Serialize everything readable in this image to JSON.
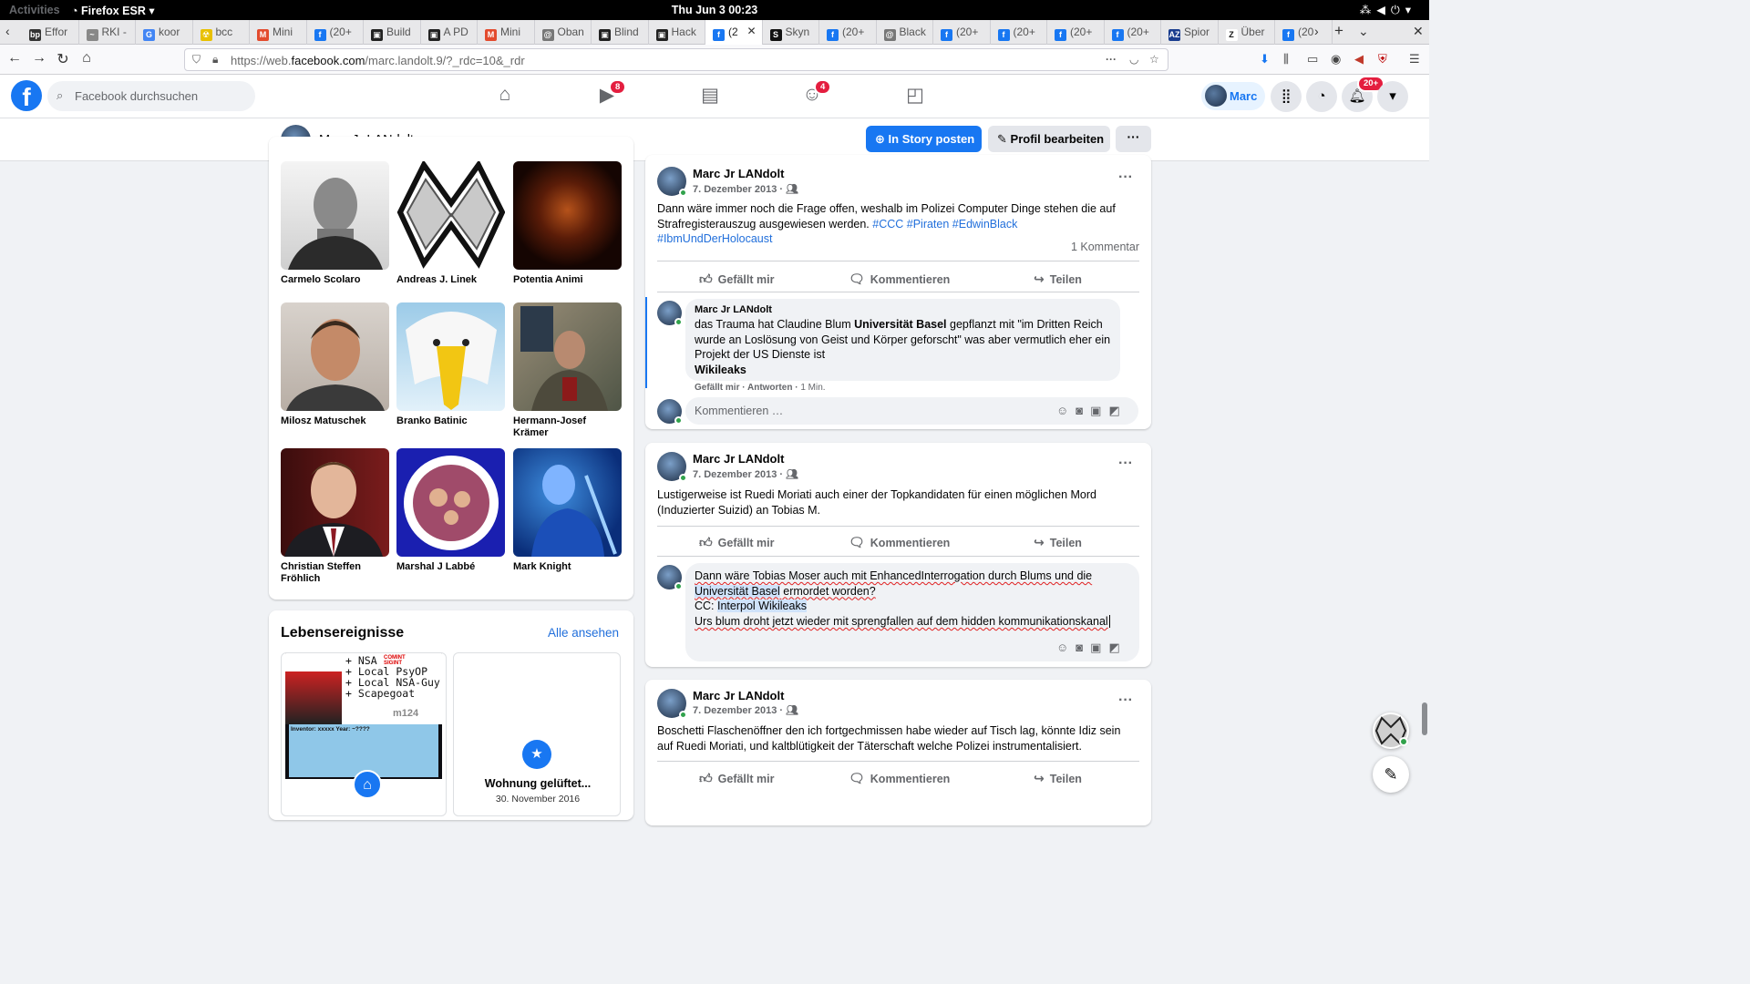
{
  "system": {
    "activities": "Activities",
    "app_name": "Firefox ESR",
    "clock": "Thu Jun 3  00:23"
  },
  "tabs": [
    {
      "label": "Effor",
      "fav_text": "bp",
      "fav_color": "#333333"
    },
    {
      "label": "RKI -",
      "fav_text": "~",
      "fav_color": "#888888"
    },
    {
      "label": "koor",
      "fav_text": "G",
      "fav_color": "#4285f4"
    },
    {
      "label": "bcc",
      "fav_text": "☢",
      "fav_color": "#e8c000"
    },
    {
      "label": "Mini",
      "fav_text": "M",
      "fav_color": "#e34b2e"
    },
    {
      "label": "(20+",
      "fav_text": "f",
      "fav_color": "#1877f2"
    },
    {
      "label": "Build",
      "fav_text": "▣",
      "fav_color": "#222222"
    },
    {
      "label": "A PD",
      "fav_text": "▣",
      "fav_color": "#222222"
    },
    {
      "label": "Mini",
      "fav_text": "M",
      "fav_color": "#e34b2e"
    },
    {
      "label": "Oban",
      "fav_text": "@",
      "fav_color": "#777777"
    },
    {
      "label": "Blind",
      "fav_text": "▣",
      "fav_color": "#222222"
    },
    {
      "label": "Hack",
      "fav_text": "▣",
      "fav_color": "#222222"
    },
    {
      "label": "(2",
      "fav_text": "f",
      "fav_color": "#1877f2",
      "active": true
    },
    {
      "label": "Skyn",
      "fav_text": "S",
      "fav_color": "#111111"
    },
    {
      "label": "(20+",
      "fav_text": "f",
      "fav_color": "#1877f2"
    },
    {
      "label": "Black",
      "fav_text": "@",
      "fav_color": "#777777"
    },
    {
      "label": "(20+",
      "fav_text": "f",
      "fav_color": "#1877f2"
    },
    {
      "label": "(20+",
      "fav_text": "f",
      "fav_color": "#1877f2"
    },
    {
      "label": "(20+",
      "fav_text": "f",
      "fav_color": "#1877f2"
    },
    {
      "label": "(20+",
      "fav_text": "f",
      "fav_color": "#1877f2"
    },
    {
      "label": "Spior",
      "fav_text": "AZ",
      "fav_color": "#1a3d8f"
    },
    {
      "label": "Über",
      "fav_text": "Z",
      "fav_color": "#ffffff"
    },
    {
      "label": "(20",
      "fav_text": "f",
      "fav_color": "#1877f2"
    }
  ],
  "url": {
    "prefix": "https://web.",
    "domain": "facebook.com",
    "path": "/marc.landolt.9/?_rdc=10&_rdr"
  },
  "fb": {
    "search_placeholder": "Facebook durchsuchen",
    "watch_badge": "8",
    "groups_badge": "4",
    "me_label": "Marc",
    "notif_badge": "20+"
  },
  "profile": {
    "name": "Marc Jr LANdolt",
    "story_btn": "In Story posten",
    "edit_btn": "Profil bearbeiten",
    "more_btn": "···"
  },
  "friends": [
    {
      "name": "Carmelo Scolaro"
    },
    {
      "name": "Andreas J. Linek"
    },
    {
      "name": "Potentia Animi"
    },
    {
      "name": "Milosz Matuschek"
    },
    {
      "name": "Branko Batinic"
    },
    {
      "name": "Hermann-Josef Krämer"
    },
    {
      "name": "Christian Steffen Fröhlich"
    },
    {
      "name": "Marshal J Labbé"
    },
    {
      "name": "Mark Knight"
    }
  ],
  "life_events": {
    "title": "Lebensereignisse",
    "see_all": "Alle ansehen",
    "event_title": "Wohnung gelüftet...",
    "event_date": "30. November 2016",
    "poster_lines": [
      "+ NSA",
      "+ Local PsyOP",
      "+ Local NSA-Guy",
      "+ Scapegoat"
    ],
    "poster_badge": "COMINT SIGINT",
    "poster_code": "m124",
    "poster_inventor": "Inventor: xxxxx        Year: ~????"
  },
  "posts": [
    {
      "author": "Marc Jr LANdolt",
      "date": "7. Dezember 2013",
      "text": "Dann wäre immer noch die Frage offen, weshalb im Polizei Computer Dinge stehen die auf Strafregisterauszug ausgewiesen werden. ",
      "hashtags": "#CCC #Piraten #EdwinBlack #IbmUndDerHolocaust",
      "comment_count": "1 Kommentar",
      "comment": {
        "author": "Marc Jr LANdolt",
        "text_a": "das Trauma hat Claudine Blum ",
        "text_b": "Universität Basel",
        "text_c": " gepflanzt mit \"im Dritten Reich wurde an Loslösung von Geist und Körper geforscht\" was aber vermutlich eher ein Projekt der US Dienste ist",
        "text_d": "Wikileaks",
        "like": "Gefällt mir",
        "reply": "Antworten",
        "time": "1 Min."
      },
      "input_placeholder": "Kommentieren …"
    },
    {
      "author": "Marc Jr LANdolt",
      "date": "7. Dezember 2013",
      "text": "Lustigerweise ist Ruedi Moriati auch einer der Topkandidaten für einen möglichen Mord (Induzierter Suizid) an Tobias M.",
      "draft": {
        "l1a": "Dann wäre Tobias Moser auch mit EnhancedInterrogation durch Blums und die",
        "l2a": "Universität Basel",
        "l2b": " ermordet worden?",
        "l3a": "CC: ",
        "l3b": "Interpol Wikileaks",
        "l4": "Urs blum droht jetzt wieder mit sprengfallen auf dem hidden kommunikationskanal"
      }
    },
    {
      "author": "Marc Jr LANdolt",
      "date": "7. Dezember 2013",
      "text": "Boschetti Flaschenöffner den ich fortgechmissen habe wieder auf Tisch lag, könnte  Idiz sein auf Ruedi Moriati, und kaltblütigkeit der Täterschaft welche Polizei instrumentalisiert."
    }
  ],
  "actions": {
    "like": "Gefällt mir",
    "comment": "Kommentieren",
    "share": "Teilen"
  },
  "colors": {
    "fb_blue": "#1877f2",
    "badge_red": "#e41e3f",
    "online_green": "#31a24c"
  }
}
